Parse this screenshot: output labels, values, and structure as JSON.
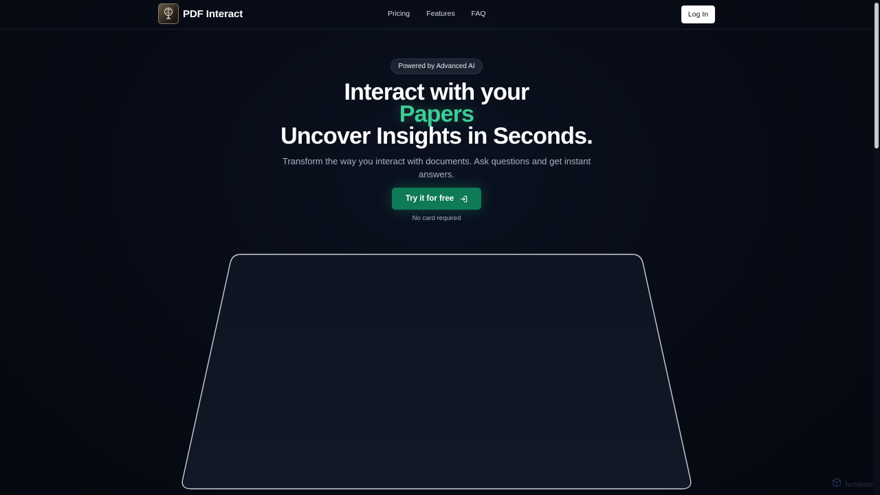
{
  "brand": {
    "name": "PDF Interact",
    "logo_icon": "brain-tree-icon"
  },
  "nav": {
    "links": [
      "Pricing",
      "Features",
      "FAQ"
    ],
    "login_label": "Log In"
  },
  "hero": {
    "badge": "Powered by Advanced AI",
    "title_line1": "Interact with your",
    "title_highlight": "Papers",
    "title_line3": "Uncover Insights in Seconds.",
    "subtitle": "Transform the way you interact with documents. Ask questions and get instant answers.",
    "cta_label": "Try it for free",
    "cta_icon": "arrow-into-box-icon",
    "note": "No card required"
  },
  "watermark": {
    "text": "TechMobile"
  },
  "colors": {
    "background": "#060a14",
    "accent": "#3fca96",
    "cta_bg": "#0e7a56",
    "text_muted": "#aab2c0"
  }
}
